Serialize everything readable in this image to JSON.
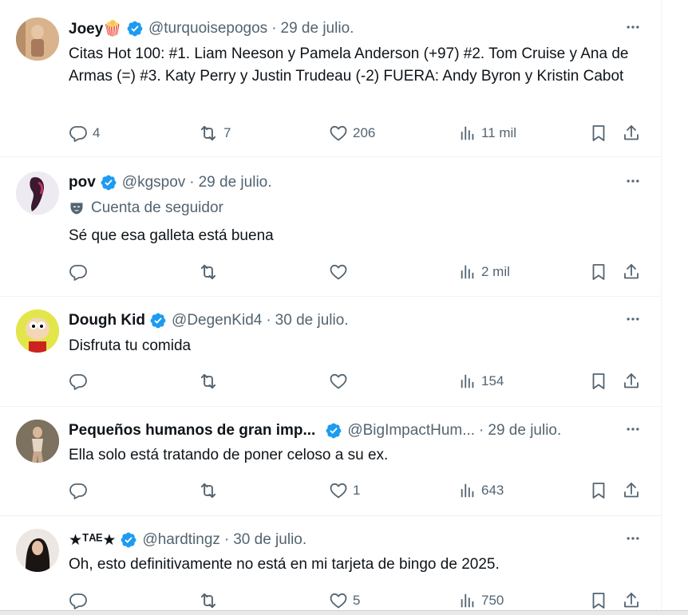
{
  "tweets": [
    {
      "name": "Joey🍿",
      "handle": "@turquoisepogos",
      "date": "29 de julio.",
      "text": "Citas Hot 100: #1. Liam Neeson y Pamela Anderson (+97) #2. Tom Cruise y Ana de Armas (=) #3. Katy Perry y Justin Trudeau (-2) FUERA: Andy Byron y Kristin Cabot",
      "replies": "4",
      "reposts": "7",
      "likes": "206",
      "views": "11 mil"
    },
    {
      "name": "pov",
      "handle": "@kgspov",
      "date": "29 de julio.",
      "follow_label": "Cuenta de seguidor",
      "text": "Sé que esa galleta está buena",
      "replies": "",
      "reposts": "",
      "likes": "",
      "views": "2 mil"
    },
    {
      "name": "Dough Kid",
      "handle": "@DegenKid4",
      "date": "30 de julio.",
      "text": "Disfruta tu comida",
      "replies": "",
      "reposts": "",
      "likes": "",
      "views": "154"
    },
    {
      "name": "Pequeños humanos de gran imp...",
      "handle": "@BigImpactHum...",
      "date": "29 de julio.",
      "text": "Ella solo está tratando de poner celoso a su ex.",
      "replies": "",
      "reposts": "",
      "likes": "1",
      "views": "643"
    },
    {
      "name": "★ᵀᴬᴱ★",
      "handle": "@hardtingz",
      "date": "30 de julio.",
      "text": "Oh, esto definitivamente no está en mi tarjeta de bingo de 2025.",
      "replies": "",
      "reposts": "",
      "likes": "5",
      "views": "750"
    }
  ],
  "dot": "·",
  "colors": {
    "verified": "#1d9bf0",
    "secondary": "#536471",
    "text": "#0f1419"
  },
  "icons": [
    "more-icon",
    "reply-icon",
    "repost-icon",
    "like-icon",
    "views-icon",
    "bookmark-icon",
    "share-icon",
    "verified-badge-icon",
    "follower-mask-icon"
  ]
}
